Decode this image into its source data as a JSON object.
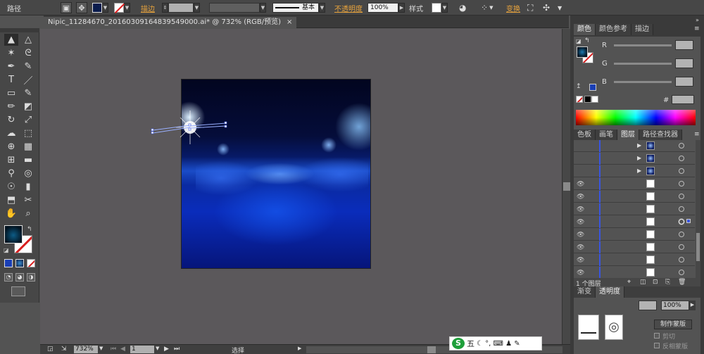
{
  "control_bar": {
    "selection_label": "路径",
    "stroke_label": "描边",
    "stroke_profile": "基本",
    "opacity_label": "不透明度",
    "opacity_value": "100%",
    "style_label": "样式",
    "transform_label": "变换"
  },
  "document": {
    "tab_title": "Nipic_11284670_20160309164839549000.ai* @ 732% (RGB/预览)",
    "close_glyph": "×"
  },
  "toolbox": {
    "tools": [
      {
        "name": "selection-tool",
        "glyph": "▲"
      },
      {
        "name": "direct-selection-tool",
        "glyph": "△"
      },
      {
        "name": "magic-wand-tool",
        "glyph": "✶"
      },
      {
        "name": "lasso-tool",
        "glyph": "ᘓ"
      },
      {
        "name": "pen-tool",
        "glyph": "✒"
      },
      {
        "name": "curvature-tool",
        "glyph": "✎"
      },
      {
        "name": "type-tool",
        "glyph": "T"
      },
      {
        "name": "line-tool",
        "glyph": "／"
      },
      {
        "name": "rectangle-tool",
        "glyph": "▭"
      },
      {
        "name": "paintbrush-tool",
        "glyph": "✎"
      },
      {
        "name": "pencil-tool",
        "glyph": "✏"
      },
      {
        "name": "eraser-tool",
        "glyph": "◩"
      },
      {
        "name": "rotate-tool",
        "glyph": "↻"
      },
      {
        "name": "scale-tool",
        "glyph": "⤢"
      },
      {
        "name": "warp-tool",
        "glyph": "☁"
      },
      {
        "name": "free-transform-tool",
        "glyph": "⬚"
      },
      {
        "name": "shape-builder-tool",
        "glyph": "⊕"
      },
      {
        "name": "perspective-grid-tool",
        "glyph": "▦"
      },
      {
        "name": "mesh-tool",
        "glyph": "⊞"
      },
      {
        "name": "gradient-tool",
        "glyph": "▬"
      },
      {
        "name": "eyedropper-tool",
        "glyph": "⚲"
      },
      {
        "name": "blend-tool",
        "glyph": "◎"
      },
      {
        "name": "symbol-sprayer-tool",
        "glyph": "☉"
      },
      {
        "name": "column-graph-tool",
        "glyph": "▮"
      },
      {
        "name": "artboard-tool",
        "glyph": "⬒"
      },
      {
        "name": "slice-tool",
        "glyph": "✂"
      },
      {
        "name": "hand-tool",
        "glyph": "✋"
      },
      {
        "name": "zoom-tool",
        "glyph": "⌕"
      }
    ]
  },
  "status_bar": {
    "zoom": "732%",
    "artboard_number": "1",
    "mode": "选择"
  },
  "ime": {
    "logo": "S",
    "mode": "五",
    "icons": "☾ °, ⌨ ♟ ✎"
  },
  "panels": {
    "color_tabs": [
      "颜色",
      "颜色参考",
      "描边"
    ],
    "rgb_labels": [
      "R",
      "G",
      "B"
    ],
    "hex_label": "#",
    "layers_tabs": [
      "色板",
      "画笔",
      "图层",
      "路径查找器"
    ],
    "layers_count": "1 个图层",
    "lower_tabs": [
      "渐变",
      "透明度"
    ],
    "lower_opacity": "100%",
    "make_mask_button": "制作蒙版",
    "clip_label": "剪切",
    "invert_mask_label": "反相蒙版"
  },
  "colors": {
    "accent": "#e8a33c",
    "panel": "#535353",
    "selection_blue": "#3a55e0"
  }
}
